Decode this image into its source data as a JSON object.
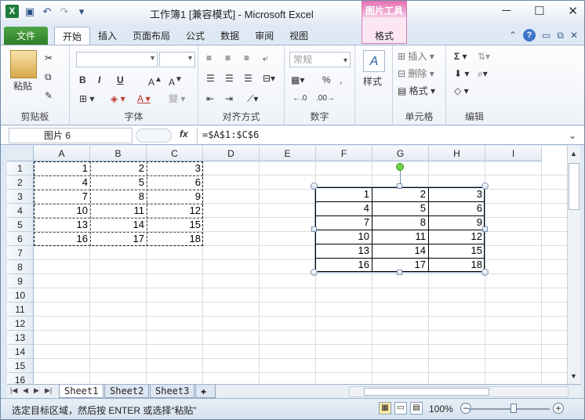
{
  "titlebar": {
    "doc_title": "工作簿1  [兼容模式]  -  Microsoft Excel",
    "context_tab_group": "图片工具",
    "logo": "X"
  },
  "tabs": {
    "file": "文件",
    "items": [
      "开始",
      "插入",
      "页面布局",
      "公式",
      "数据",
      "审阅",
      "视图"
    ],
    "context_format": "格式",
    "help": "?"
  },
  "ribbon": {
    "paste_label": "粘贴",
    "clipboard": "剪贴板",
    "font": "字体",
    "alignment": "对齐方式",
    "number": "数字",
    "number_format": "常规",
    "styles_label": "样式",
    "cells": "单元格",
    "insert": "插入",
    "delete": "删除",
    "format": "格式",
    "editing": "编辑",
    "bold": "B",
    "italic": "I",
    "underline": "U",
    "percent": "%"
  },
  "formula_bar": {
    "name_box": "图片 6",
    "fx": "fx",
    "formula": "=$A$1:$C$6"
  },
  "sheet": {
    "columns": [
      "A",
      "B",
      "C",
      "D",
      "E",
      "F",
      "G",
      "H",
      "I"
    ],
    "rows": [
      "1",
      "2",
      "3",
      "4",
      "5",
      "6",
      "7",
      "8",
      "9",
      "10",
      "11",
      "12",
      "13",
      "14",
      "15",
      "16"
    ],
    "values": [
      [
        1,
        2,
        3
      ],
      [
        4,
        5,
        6
      ],
      [
        7,
        8,
        9
      ],
      [
        10,
        11,
        12
      ],
      [
        13,
        14,
        15
      ],
      [
        16,
        17,
        18
      ]
    ]
  },
  "picture": {
    "values": [
      [
        1,
        2,
        3
      ],
      [
        4,
        5,
        6
      ],
      [
        7,
        8,
        9
      ],
      [
        10,
        11,
        12
      ],
      [
        13,
        14,
        15
      ],
      [
        16,
        17,
        18
      ]
    ]
  },
  "sheet_tabs": [
    "Sheet1",
    "Sheet2",
    "Sheet3"
  ],
  "status": {
    "message": "选定目标区域，然后按 ENTER 或选择“粘贴”",
    "zoom": "100%"
  }
}
